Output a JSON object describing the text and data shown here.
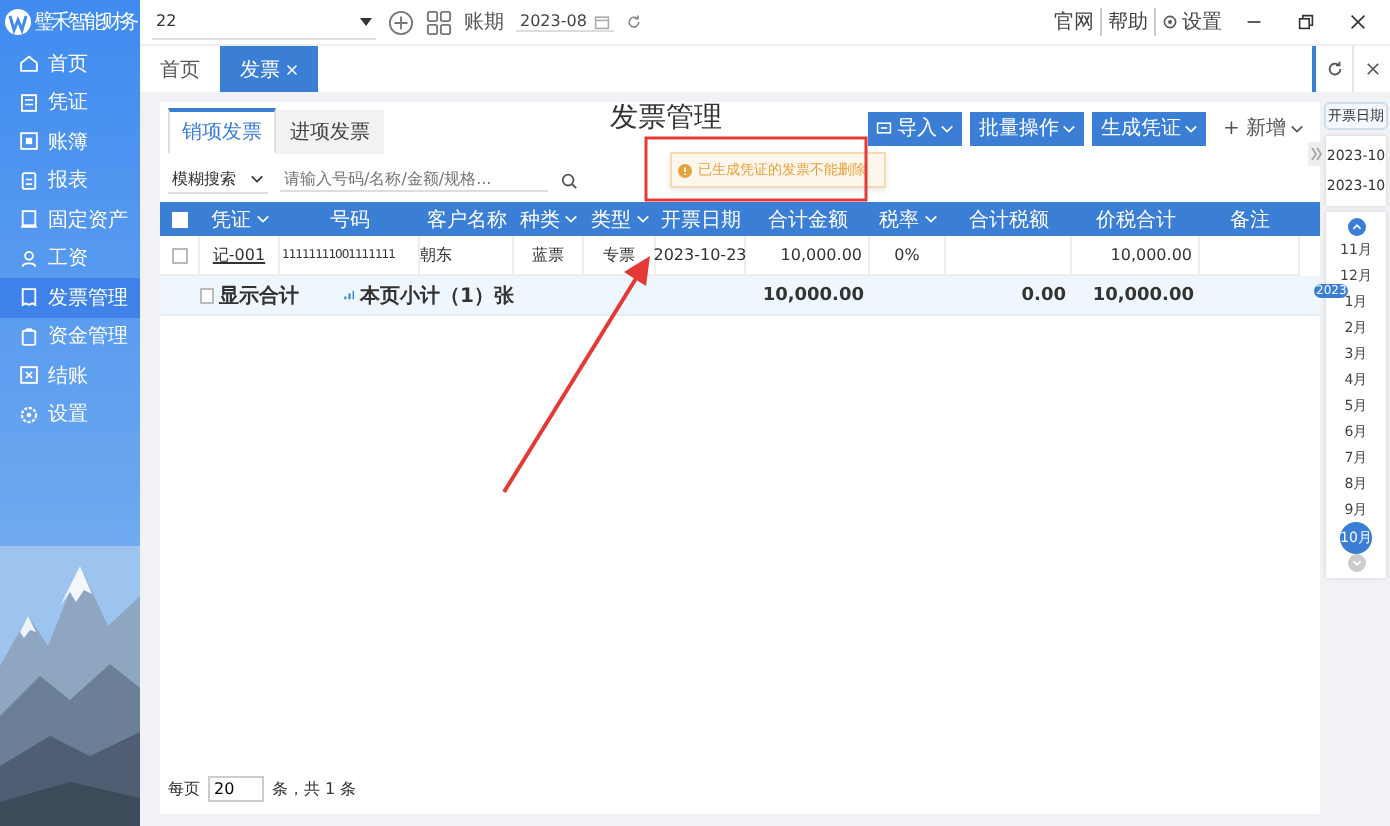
{
  "app": {
    "logo": "璧禾智能财务"
  },
  "sidebar": {
    "items": [
      {
        "label": "首页",
        "selected": false
      },
      {
        "label": "凭证",
        "selected": false
      },
      {
        "label": "账簿",
        "selected": false
      },
      {
        "label": "报表",
        "selected": false
      },
      {
        "label": "固定资产",
        "selected": false
      },
      {
        "label": "工资",
        "selected": false
      },
      {
        "label": "发票管理",
        "selected": true
      },
      {
        "label": "资金管理",
        "selected": false
      },
      {
        "label": "结账",
        "selected": false
      },
      {
        "label": "设置",
        "selected": false
      }
    ]
  },
  "topbar": {
    "account": "22",
    "period_label": "账期",
    "period": "2023-08",
    "links": [
      "官网",
      "帮助",
      "设置"
    ]
  },
  "tabs": [
    {
      "label": "首页",
      "selected": false,
      "closable": false
    },
    {
      "label": "发票",
      "selected": true,
      "closable": true
    }
  ],
  "page": {
    "title": "发票管理",
    "subtabs": [
      {
        "label": "销项发票",
        "selected": true
      },
      {
        "label": "进项发票",
        "selected": false
      }
    ],
    "actions": [
      {
        "label": "导入",
        "kind": "import"
      },
      {
        "label": "批量操作",
        "kind": "primary"
      },
      {
        "label": "生成凭证",
        "kind": "primary"
      },
      {
        "label": "+ 新增",
        "kind": "plain"
      }
    ],
    "filter": {
      "mode": "模糊搜索",
      "placeholder": "请输入号码/名称/金额/规格..."
    },
    "table": {
      "header_checked": false,
      "columns": [
        {
          "label": "凭证",
          "sortable": true
        },
        {
          "label": "号码",
          "sortable": false
        },
        {
          "label": "客户名称",
          "sortable": false
        },
        {
          "label": "种类",
          "sortable": true
        },
        {
          "label": "类型",
          "sortable": true
        },
        {
          "label": "开票日期",
          "sortable": false
        },
        {
          "label": "合计金额",
          "sortable": false
        },
        {
          "label": "税率",
          "sortable": true
        },
        {
          "label": "合计税额",
          "sortable": false
        },
        {
          "label": "价税合计",
          "sortable": false
        },
        {
          "label": "备注",
          "sortable": false
        }
      ],
      "rows": [
        {
          "checked": false,
          "cells": [
            "记-001",
            "11111111001111111",
            "朝东",
            "蓝票",
            "专票",
            "2023-10-23",
            "10,000.00",
            "0%",
            "",
            "10,000.00",
            ""
          ]
        }
      ],
      "summary": {
        "show_total_label": "显示合计",
        "checked": false,
        "subtotal": "本页小计（1）张",
        "amount": "10,000.00",
        "tax": "0.00",
        "total": "10,000.00"
      }
    },
    "pagination": {
      "per_page_label": "每页",
      "per_page": "20",
      "count_text": "条，共 1 条"
    }
  },
  "toast": {
    "message": "已生成凭证的发票不能删除"
  },
  "date_panel": {
    "label": "开票日期",
    "from": "2023-10",
    "to": "2023-10",
    "months": [
      {
        "label": "11月",
        "selected": false
      },
      {
        "label": "12月",
        "selected": false
      },
      {
        "label": "1月",
        "selected": false,
        "year": "2023"
      },
      {
        "label": "2月",
        "selected": false
      },
      {
        "label": "3月",
        "selected": false
      },
      {
        "label": "4月",
        "selected": false
      },
      {
        "label": "5月",
        "selected": false
      },
      {
        "label": "6月",
        "selected": false
      },
      {
        "label": "7月",
        "selected": false
      },
      {
        "label": "8月",
        "selected": false
      },
      {
        "label": "9月",
        "selected": false
      },
      {
        "label": "10月",
        "selected": true
      }
    ]
  }
}
